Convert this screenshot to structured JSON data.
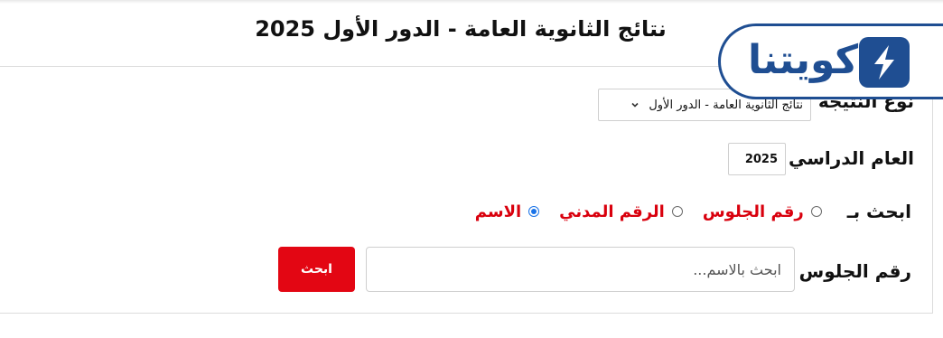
{
  "page_title": "نتائج الثانوية العامة - الدور الأول 2025",
  "logo": {
    "text": "كويتنا",
    "icon": "lightning-bolt-icon",
    "color": "#1f4e92"
  },
  "form": {
    "result_type": {
      "label": "نوع النتيجة",
      "selected": "نتائج الثانوية العامة - الدور الأول"
    },
    "academic_year": {
      "label": "العام الدراسي",
      "selected": "2025"
    },
    "search_by": {
      "label": "ابحث بـ",
      "options": [
        {
          "label": "رقم الجلوس",
          "checked": false
        },
        {
          "label": "الرقم المدني",
          "checked": false
        },
        {
          "label": "الاسم",
          "checked": true
        }
      ]
    },
    "seat_number": {
      "label": "رقم الجلوس",
      "placeholder": "ابحث بالاسم..."
    },
    "search_button_label": "ابحث"
  },
  "colors": {
    "accent_red": "#e30613",
    "radio_label_red": "#d9000d",
    "radio_checked_blue": "#1a73e8",
    "brand_blue": "#1f4e92"
  }
}
